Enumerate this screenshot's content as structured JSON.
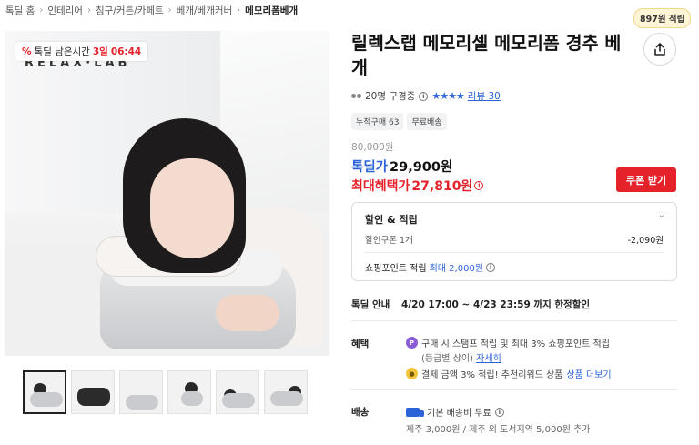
{
  "breadcrumb": [
    "톡딜 홈",
    "인테리어",
    "침구/커튼/카페트",
    "베개/베개커버",
    "메모리폼베개"
  ],
  "deal_badge": {
    "icon": "%",
    "label": "톡딜 남은시간",
    "days": "3일",
    "time": "06:44"
  },
  "brand_watermark": "RELAX·LAB",
  "thumbnails_count": 6,
  "points_badge": "897원 적립",
  "title": "릴렉스랩 메모리셀 메모리폼 경추 베개",
  "rating": {
    "viewers": "20명 구경중",
    "stars": "★★★★",
    "review_link": "리뷰 30"
  },
  "tags": [
    "누적구매 63",
    "무료배송"
  ],
  "price": {
    "original": "80,000원",
    "deal_label": "톡딜가",
    "deal_value": "29,900원",
    "max_label": "최대혜택가",
    "max_value": "27,810원"
  },
  "coupon_button": "쿠폰 받기",
  "discount": {
    "header": "할인 & 적립",
    "coupon_label": "할인쿠폰 1개",
    "coupon_amount": "-2,090원",
    "points_label": "쇼핑포인트 적립",
    "points_value": "최대 2,000원"
  },
  "deal_info": {
    "label": "톡딜 안내",
    "value": "4/20 17:00 ~ 4/23 23:59 까지 한정할인"
  },
  "benefits": {
    "label": "혜택",
    "line1": "구매 시 스탬프 적립 및 최대 3% 쇼핑포인트 적립",
    "line1b": "(등급별 상이)",
    "line1_link": "자세히",
    "line2": "결제 금액 3% 적립! 추천리워드 상품",
    "line2_link": "상품 더보기"
  },
  "shipping": {
    "label": "배송",
    "line1": "기본 배송비 무료",
    "line2": "제주 3,000원 / 제주 외 도서지역 5,000원 추가"
  },
  "colors": {
    "accent_red": "#e5222a",
    "accent_blue": "#2b63d9",
    "points_bg": "#fff4d6"
  }
}
